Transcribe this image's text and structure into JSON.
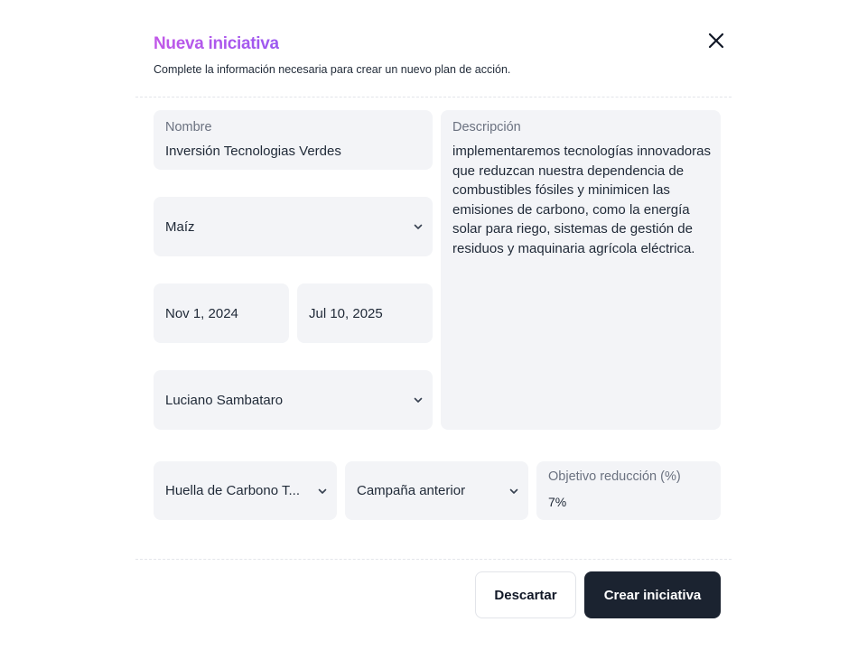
{
  "dialog": {
    "title": "Nueva iniciativa",
    "subtitle": "Complete la información necesaria para crear un nuevo plan de acción.",
    "close_icon": "close-icon"
  },
  "form": {
    "nombre": {
      "label": "Nombre",
      "value": "Inversión Tecnologias Verdes"
    },
    "cultivo": {
      "value": "Maíz"
    },
    "fecha_inicio": {
      "value": "Nov 1, 2024"
    },
    "fecha_fin": {
      "value": "Jul 10, 2025"
    },
    "responsable": {
      "value": "Luciano Sambataro"
    },
    "descripcion": {
      "label": "Descripción",
      "value": "implementaremos tecnologías innovadoras que reduzcan nuestra dependencia de combustibles fósiles y minimicen las emisiones de carbono, como la energía solar para riego, sistemas de gestión de residuos y maquinaria agrícola eléctrica."
    },
    "indicador": {
      "value": "Huella de Carbono T..."
    },
    "base": {
      "value": "Campaña anterior"
    },
    "objetivo": {
      "label": "Objetivo reducción (%)",
      "value": "7%"
    }
  },
  "footer": {
    "discard_label": "Descartar",
    "create_label": "Crear iniciativa"
  },
  "colors": {
    "title_gradient_start": "#c157e8",
    "title_gradient_end": "#9b59f0",
    "field_bg": "#f3f4f7",
    "primary_button": "#1b2330"
  }
}
